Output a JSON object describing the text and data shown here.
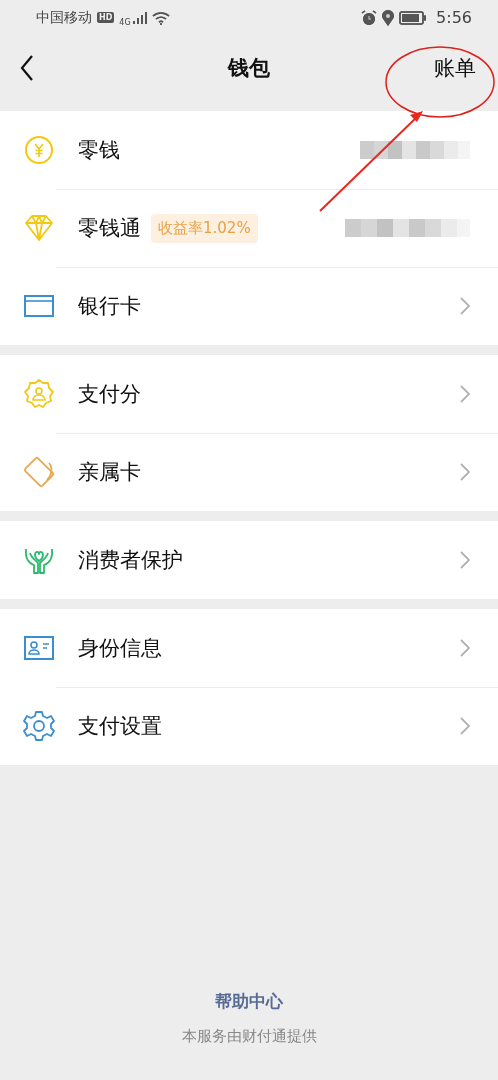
{
  "status_bar": {
    "carrier": "中国移动",
    "hd": "HD",
    "network": "4G",
    "time": "5:56"
  },
  "nav": {
    "title": "钱包",
    "action": "账单"
  },
  "groups": [
    {
      "items": [
        {
          "kind": "coin",
          "label": "零钱",
          "redacted": true
        },
        {
          "kind": "diamond",
          "label": "零钱通",
          "badge": "收益率1.02%",
          "redacted": true
        },
        {
          "kind": "card",
          "label": "银行卡",
          "redacted": false
        }
      ]
    },
    {
      "items": [
        {
          "kind": "badge",
          "label": "支付分",
          "redacted": false
        },
        {
          "kind": "tilted-card",
          "label": "亲属卡",
          "redacted": false
        }
      ]
    },
    {
      "items": [
        {
          "kind": "hands",
          "label": "消费者保护",
          "redacted": false
        }
      ]
    },
    {
      "items": [
        {
          "kind": "id-card",
          "label": "身份信息",
          "redacted": false
        },
        {
          "kind": "gear",
          "label": "支付设置",
          "redacted": false
        }
      ]
    }
  ],
  "footer": {
    "link": "帮助中心",
    "note": "本服务由财付通提供"
  }
}
